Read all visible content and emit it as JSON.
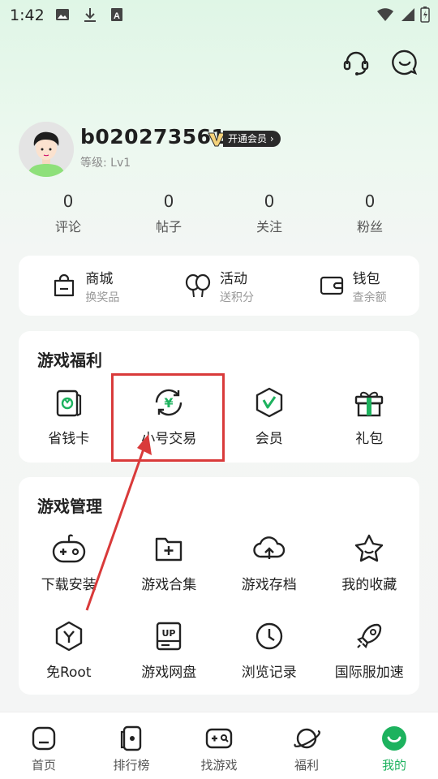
{
  "status": {
    "time": "1:42"
  },
  "profile": {
    "username": "b020273561",
    "vip_label": "开通会员 ›",
    "level": "等级: Lv1"
  },
  "stats": [
    {
      "value": "0",
      "label": "评论"
    },
    {
      "value": "0",
      "label": "帖子"
    },
    {
      "value": "0",
      "label": "关注"
    },
    {
      "value": "0",
      "label": "粉丝"
    }
  ],
  "shop": [
    {
      "title": "商城",
      "sub": "换奖品",
      "icon": "shopping-bag-icon"
    },
    {
      "title": "活动",
      "sub": "送积分",
      "icon": "balloon-icon"
    },
    {
      "title": "钱包",
      "sub": "查余额",
      "icon": "wallet-icon"
    }
  ],
  "welfare": {
    "title": "游戏福利",
    "items": [
      {
        "label": "省钱卡",
        "icon": "saving-card-icon"
      },
      {
        "label": "小号交易",
        "icon": "account-trade-icon"
      },
      {
        "label": "会员",
        "icon": "member-icon"
      },
      {
        "label": "礼包",
        "icon": "gift-icon"
      }
    ]
  },
  "manage": {
    "title": "游戏管理",
    "items": [
      {
        "label": "下载安装",
        "icon": "gamepad-download-icon"
      },
      {
        "label": "游戏合集",
        "icon": "folder-plus-icon"
      },
      {
        "label": "游戏存档",
        "icon": "cloud-upload-icon"
      },
      {
        "label": "我的收藏",
        "icon": "star-icon"
      },
      {
        "label": "免Root",
        "icon": "hexagon-y-icon"
      },
      {
        "label": "游戏网盘",
        "icon": "up-disk-icon"
      },
      {
        "label": "浏览记录",
        "icon": "clock-icon"
      },
      {
        "label": "国际服加速",
        "icon": "rocket-icon"
      }
    ]
  },
  "tabs": [
    {
      "label": "首页",
      "icon": "home-icon"
    },
    {
      "label": "排行榜",
      "icon": "ranking-icon"
    },
    {
      "label": "找游戏",
      "icon": "find-game-icon"
    },
    {
      "label": "福利",
      "icon": "planet-icon"
    },
    {
      "label": "我的",
      "icon": "me-icon",
      "active": true
    }
  ],
  "colors": {
    "accent": "#1db25e",
    "highlight": "#d93a3a"
  }
}
